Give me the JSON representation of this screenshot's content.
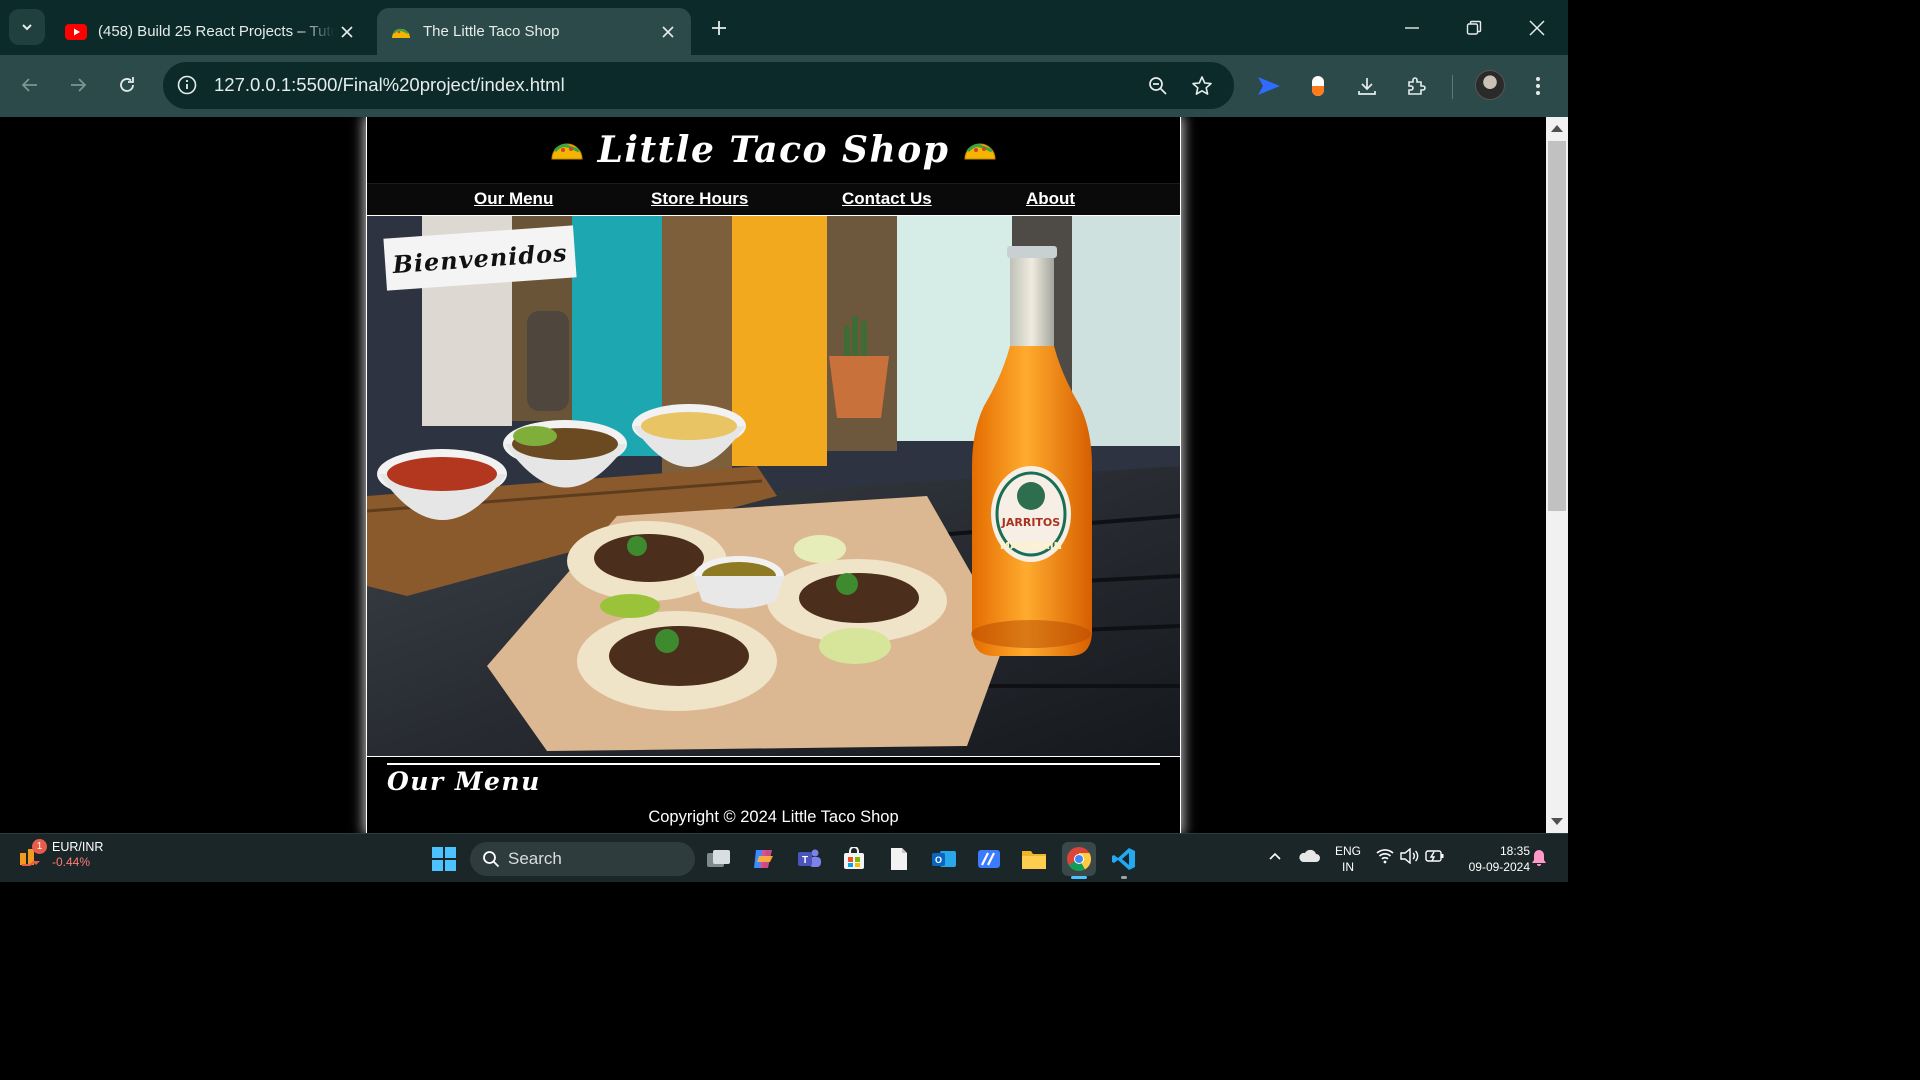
{
  "browser": {
    "tabs": [
      {
        "title": "(458) Build 25 React Projects – Tuto",
        "favicon": "youtube-icon"
      },
      {
        "title": "The Little Taco Shop",
        "favicon": "taco-icon"
      }
    ],
    "url": "127.0.0.1:5500/Final%20project/index.html",
    "accent": "#2b4a49"
  },
  "site": {
    "title": "Little Taco Shop",
    "nav": [
      "Our Menu",
      "Store Hours",
      "Contact Us",
      "About"
    ],
    "hero_banner": "Bienvenidos",
    "section_heading": "Our Menu",
    "copyright": "Copyright © 2024 Little Taco Shop",
    "bottle_brand": "JARRITOS",
    "bottle_flavor": "MANDARIN"
  },
  "taskbar": {
    "widget_title": "EUR/INR",
    "widget_value": "-0.44%",
    "widget_badge": "1",
    "search_label": "Search",
    "lang_line1": "ENG",
    "lang_line2": "IN",
    "time": "18:35",
    "date": "09-09-2024"
  }
}
